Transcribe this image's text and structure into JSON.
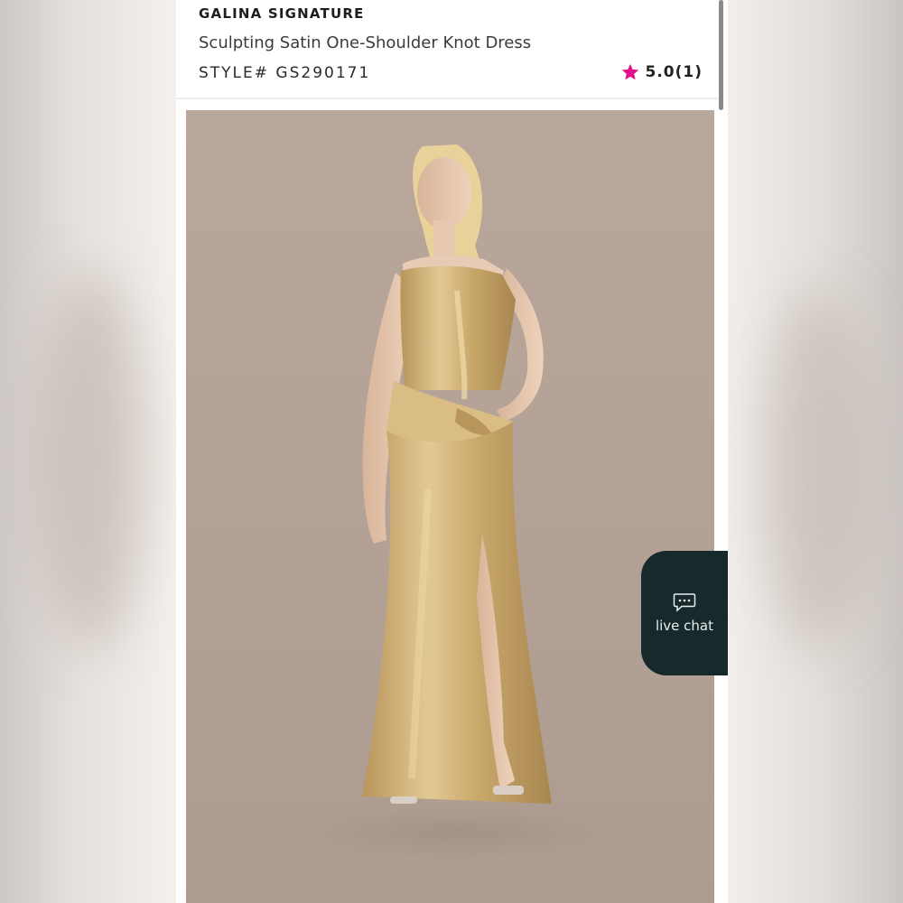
{
  "product": {
    "brand": "GALINA SIGNATURE",
    "name": "Sculpting Satin One-Shoulder Knot Dress",
    "style": "STYLE# GS290171",
    "rating": "5.0(1)"
  },
  "colors": {
    "star": "#e0118a",
    "chat_background": "#17292b",
    "dress": "#c9a96a"
  },
  "icons": {
    "rating": "star-icon",
    "chat": "chat-bubble-icon"
  },
  "live_chat": {
    "label": "live chat"
  }
}
